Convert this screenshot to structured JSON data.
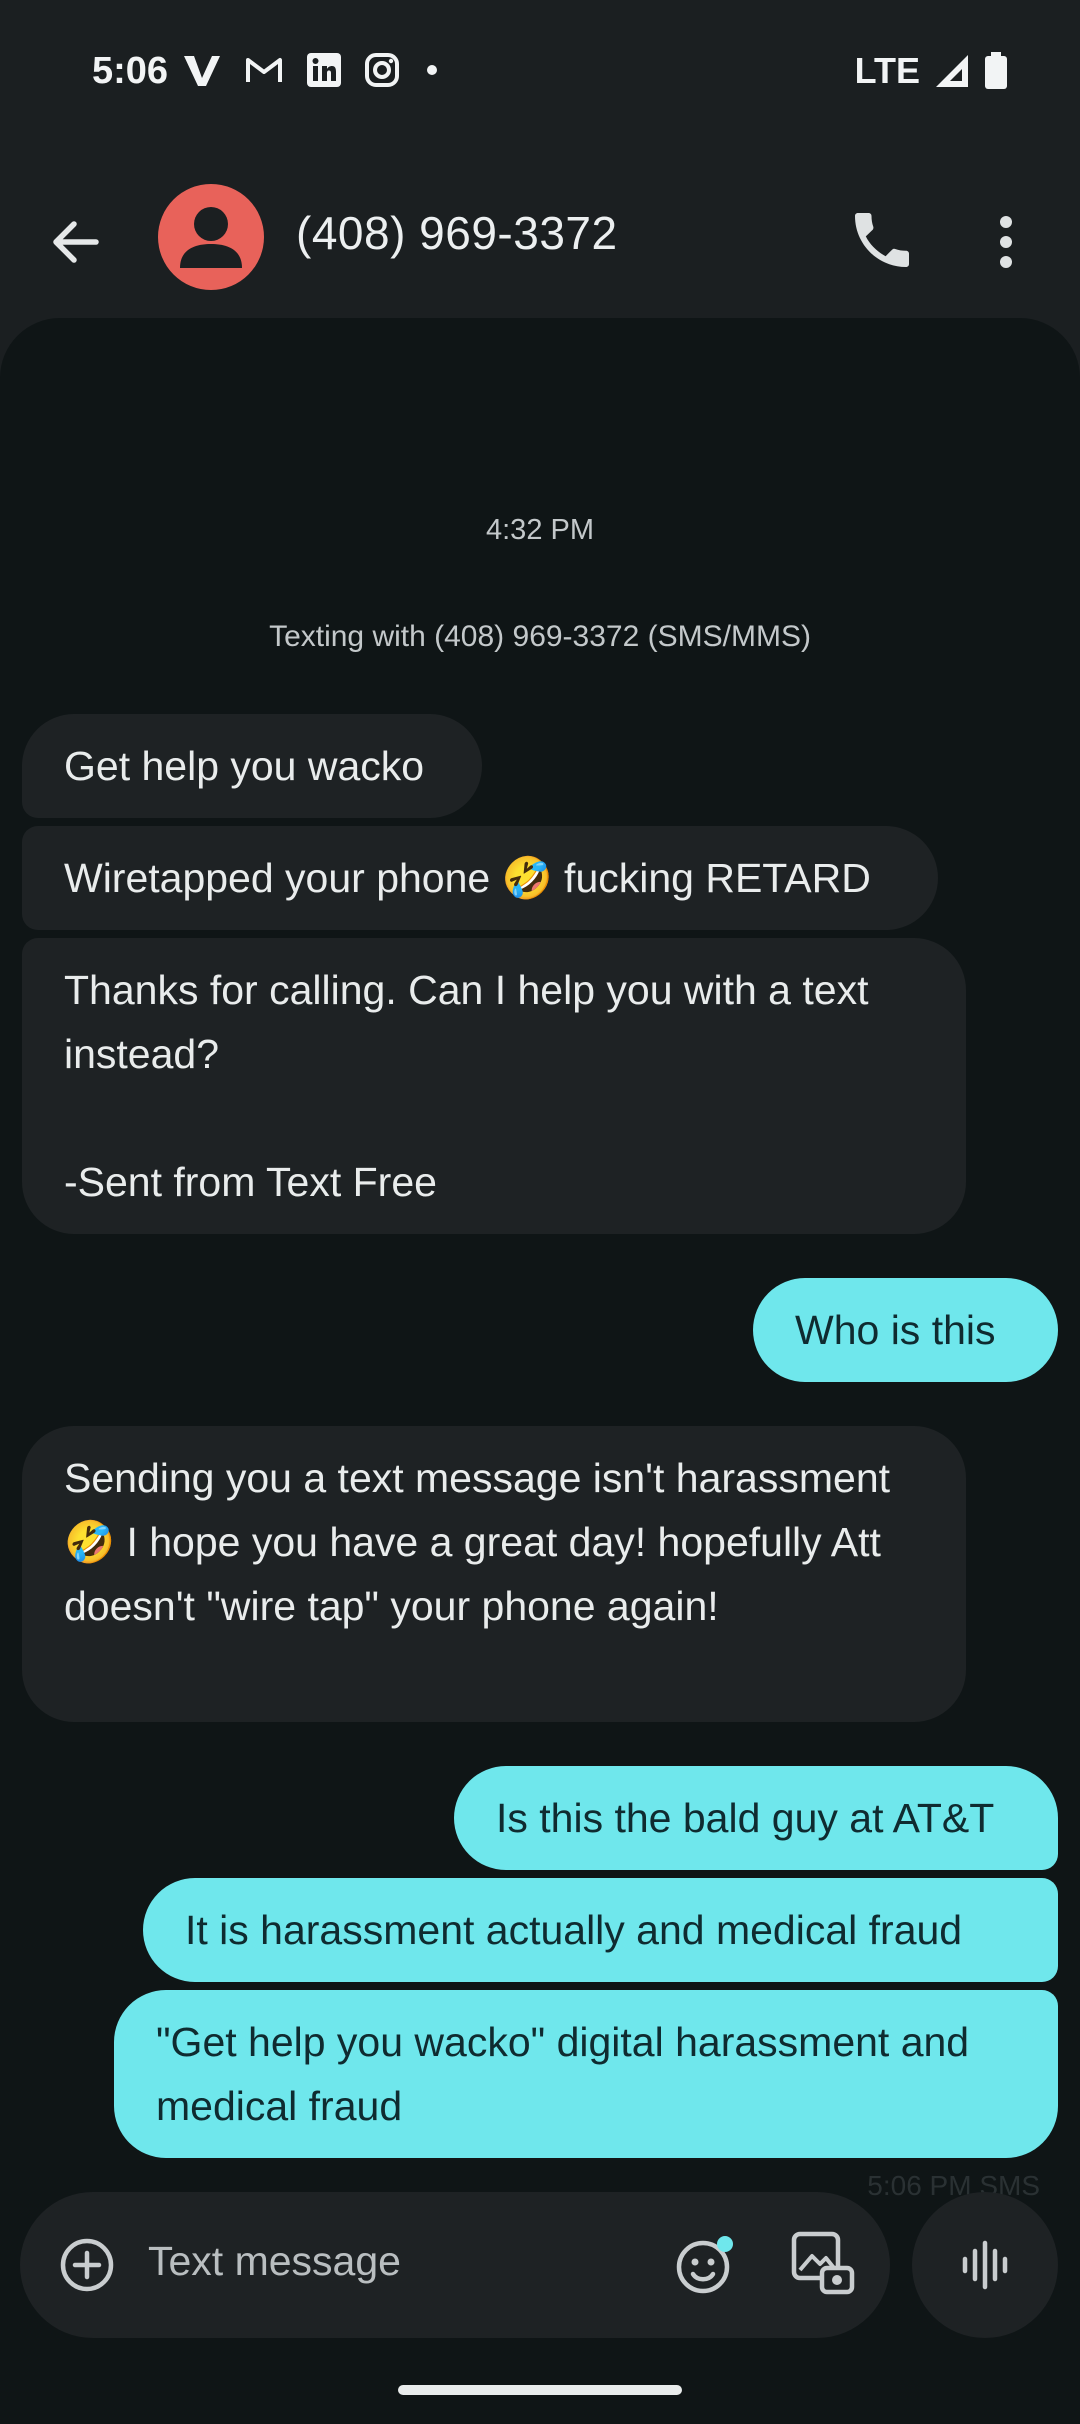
{
  "status_bar": {
    "time": "5:06",
    "network": "LTE",
    "app_icons": [
      "verizon-icon",
      "gmail-icon",
      "linkedin-icon",
      "instagram-icon",
      "dot-icon"
    ],
    "system_icons": [
      "signal-icon",
      "battery-icon"
    ]
  },
  "header": {
    "title": "(408) 969-3372",
    "avatar_color": "#e8625a",
    "icons": [
      "back-arrow-icon",
      "phone-icon",
      "more-vert-icon"
    ]
  },
  "conversation": {
    "timestamp": "4:32 PM",
    "info": "Texting with (408) 969-3372 (SMS/MMS)",
    "messages": [
      {
        "direction": "incoming",
        "text": "Get help you wacko"
      },
      {
        "direction": "incoming",
        "text": "Wiretapped your phone 🤣 fucking RETARD"
      },
      {
        "direction": "incoming",
        "text": "Thanks for calling. Can I help you with a text instead?\n\n-Sent from Text Free"
      },
      {
        "direction": "outgoing",
        "text": "Who is this"
      },
      {
        "direction": "incoming",
        "text": "Sending you a text message isn't harassment 🤣 I hope you have a great day! hopefully Att doesn't \"wire tap\" your phone again!"
      },
      {
        "direction": "outgoing",
        "text": "Is this the bald guy at AT&T"
      },
      {
        "direction": "outgoing",
        "text": "It is harassment actually and medical fraud"
      },
      {
        "direction": "outgoing",
        "text": "\"Get help you wacko\" digital harassment and medical fraud"
      }
    ],
    "last_status": "5:06 PM SMS"
  },
  "composer": {
    "placeholder": "Text message",
    "icons": [
      "add-circle-icon",
      "emoji-icon",
      "gallery-icon",
      "voice-icon"
    ]
  },
  "colors": {
    "background": "#1b1f21",
    "panel": "#0f1516",
    "incoming_bubble": "#1e2224",
    "outgoing_bubble": "#6fe7ec"
  }
}
